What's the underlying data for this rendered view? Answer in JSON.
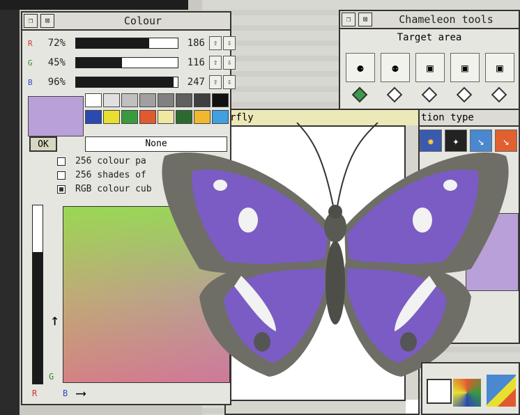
{
  "colour_window": {
    "title": "Colour",
    "channels": [
      {
        "label": "R",
        "percent": "72%",
        "fraction": 0.72,
        "value": "186",
        "color": "#cc3333"
      },
      {
        "label": "G",
        "percent": "45%",
        "fraction": 0.45,
        "value": "116",
        "color": "#33883a"
      },
      {
        "label": "B",
        "percent": "96%",
        "fraction": 0.96,
        "value": "247",
        "color": "#3344cc"
      }
    ],
    "ok_label": "OK",
    "none_label": "None",
    "options": [
      "256 colour pa",
      "256 shades of",
      "RGB colour cub"
    ],
    "axis_g": "G",
    "axis_r": "R",
    "axis_b": "B",
    "current_colour": "#b9a0d8"
  },
  "chameleon_window": {
    "title": "Chameleon tools",
    "target_label": "Target area",
    "action_label": "tion type"
  },
  "butterfly_window": {
    "title": "rfly"
  },
  "accent_colors": {
    "purple": "#7b5cc4",
    "window_bg": "#e6e6e0"
  }
}
